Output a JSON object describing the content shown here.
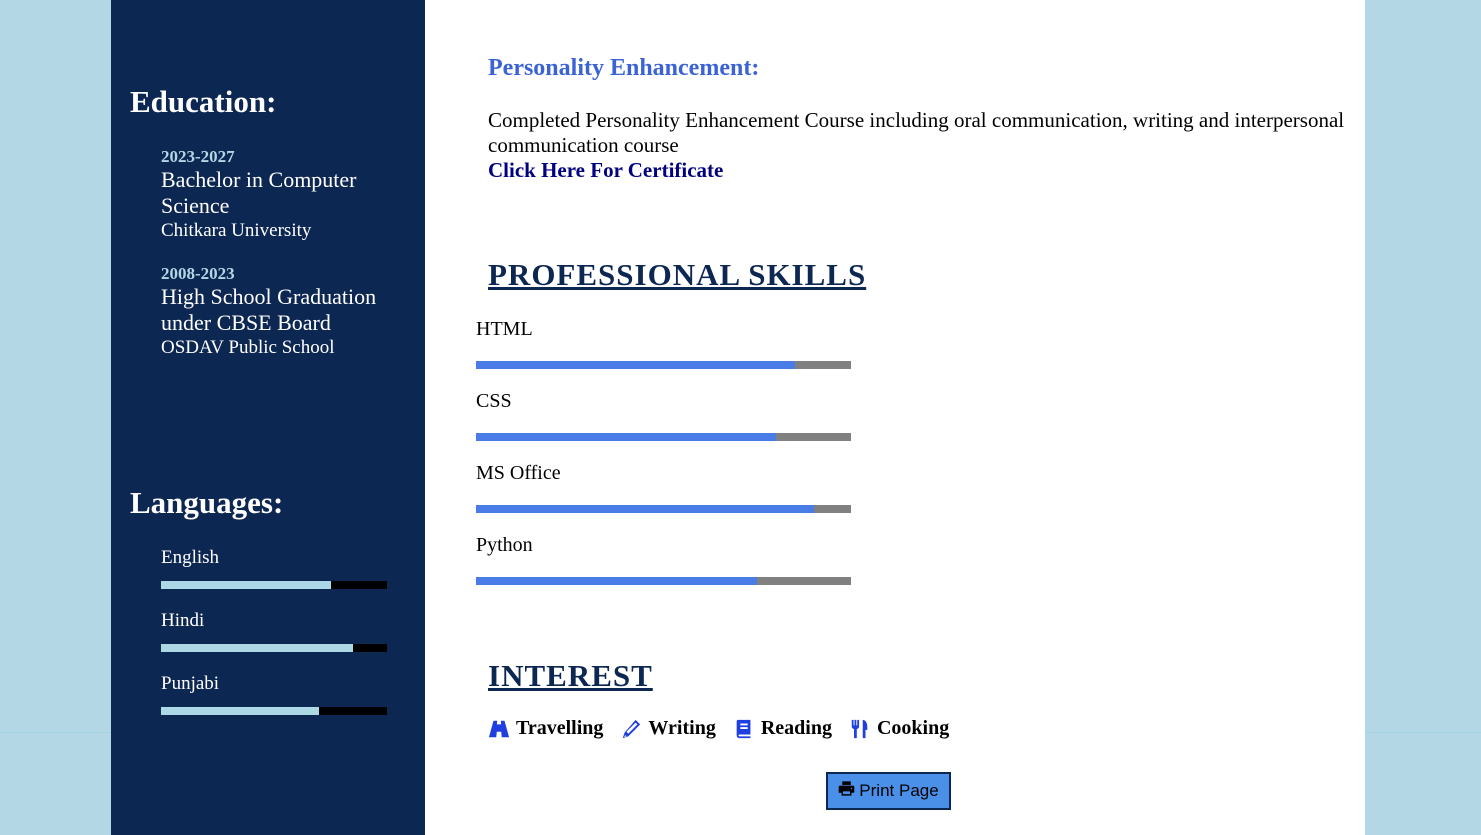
{
  "sidebar": {
    "education_heading": "Education:",
    "education": [
      {
        "years": "2023-2027",
        "degree": "Bachelor in Computer Science",
        "school": "Chitkara University"
      },
      {
        "years": "2008-2023",
        "degree": "High School Graduation under CBSE Board",
        "school": "OSDAV Public School"
      }
    ],
    "languages_heading": "Languages:",
    "languages": [
      {
        "name": "English",
        "level": 0.75
      },
      {
        "name": "Hindi",
        "level": 0.85
      },
      {
        "name": "Punjabi",
        "level": 0.7
      }
    ]
  },
  "main": {
    "personality": {
      "title": "Personality Enhancement:",
      "text": "Completed Personality Enhancement Course including oral communication, writing and interpersonal communication course",
      "link_label": "Click Here For Certificate"
    },
    "skills_heading": "PROFESSIONAL SKILLS",
    "skills": [
      {
        "name": "HTML",
        "level": 0.85
      },
      {
        "name": "CSS",
        "level": 0.8
      },
      {
        "name": "MS Office",
        "level": 0.9
      },
      {
        "name": "Python",
        "level": 0.75
      }
    ],
    "interest_heading": "INTEREST",
    "interests": [
      {
        "label": "Travelling",
        "icon": "road-icon"
      },
      {
        "label": "Writing",
        "icon": "pencil-icon"
      },
      {
        "label": "Reading",
        "icon": "book-icon"
      },
      {
        "label": "Cooking",
        "icon": "utensils-icon"
      }
    ],
    "print_label": "Print Page"
  },
  "colors": {
    "page_background": "#b3d7e5",
    "sidebar_background": "#0d2753",
    "skill_fill": "#4a7ce8",
    "language_fill": "#add8e6",
    "accent_title": "#3b63d6",
    "icon_color": "#1f3fe0"
  }
}
